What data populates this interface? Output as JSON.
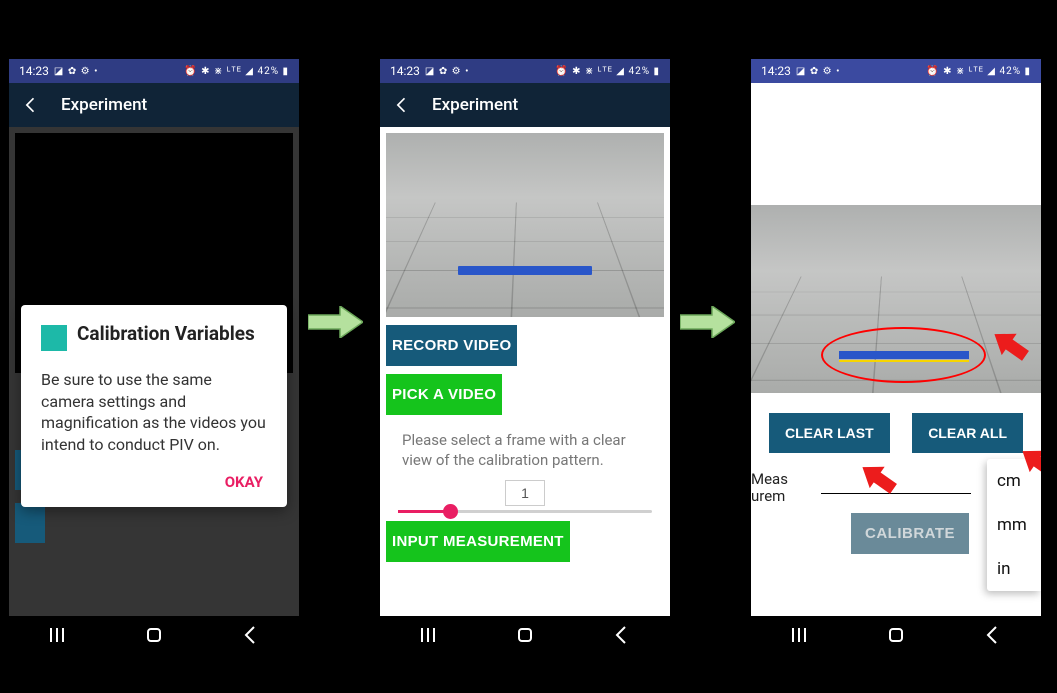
{
  "status": {
    "time": "14:23",
    "left_icons": "◪ ✿ ⚙ •",
    "right_icons": "⏰ ✱ ⋇ ᴸᵀᴱ ◢ 42% ▮"
  },
  "appbar": {
    "title": "Experiment"
  },
  "dialog": {
    "title": "Calibration Variables",
    "body": "Be sure to use the same camera settings and magnification as the videos you intend to conduct PIV on.",
    "ok": "OKAY"
  },
  "screen2": {
    "record": "RECORD VIDEO",
    "pick": "PICK A VIDEO",
    "instruct": "Please select a frame with a clear view of the calibration pattern.",
    "frame": "1",
    "input_meas": "INPUT MEASUREMENT"
  },
  "screen3": {
    "clear_last": "CLEAR LAST",
    "clear_all": "CLEAR ALL",
    "meas_label": "Measurement:",
    "calibrate": "CALIBRATE",
    "units": [
      "cm",
      "mm",
      "in"
    ]
  }
}
